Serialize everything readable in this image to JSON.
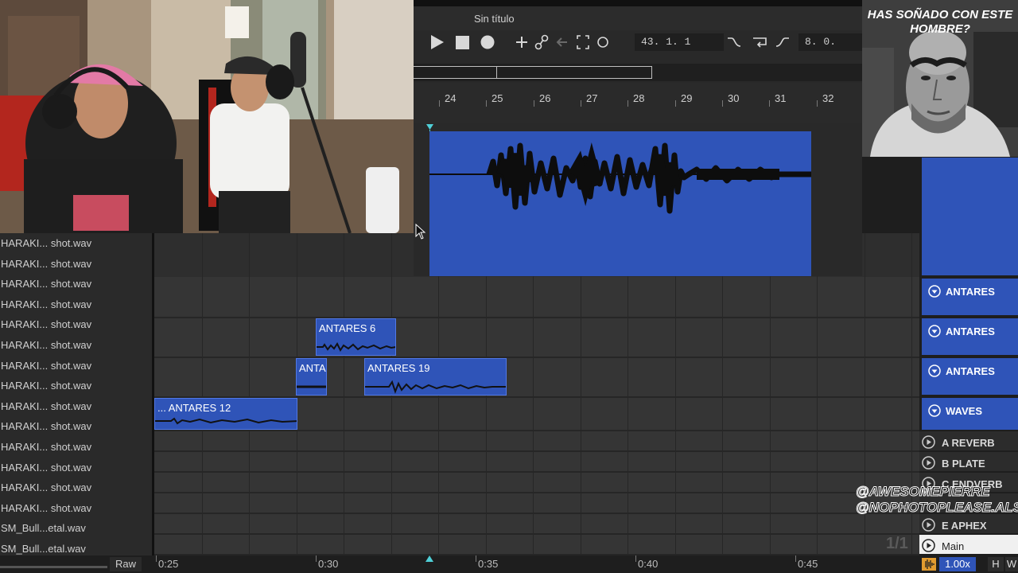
{
  "browser": {
    "files": [
      "HARAKI... shot.wav",
      "HARAKI... shot.wav",
      "HARAKI... shot.wav",
      "HARAKI... shot.wav",
      "HARAKI... shot.wav",
      "HARAKI... shot.wav",
      "HARAKI... shot.wav",
      "HARAKI... shot.wav",
      "HARAKI... shot.wav",
      "HARAKI... shot.wav",
      "HARAKI... shot.wav",
      "HARAKI... shot.wav",
      "HARAKI... shot.wav",
      "HARAKI... shot.wav",
      "SM_Bull...etal.wav",
      "SM_Bull...etal.wav"
    ],
    "raw_label": "Raw"
  },
  "clips": {
    "c1": "ANTARES 6",
    "c2": "ANTA",
    "c3": "ANTARES 19",
    "c4": "... ANTARES 12"
  },
  "tracks": {
    "t1": "ANTARES",
    "t2": "ANTARES",
    "t3": "ANTARES",
    "t4": "WAVES"
  },
  "returns": {
    "r1": "A REVERB",
    "r2": "B PLATE",
    "r3": "C ENDVERB",
    "r4": "E APHEX",
    "r5": "Main"
  },
  "page_counter": "1/1",
  "time_ruler": [
    "0:25",
    "0:30",
    "0:35",
    "0:40",
    "0:45"
  ],
  "status": {
    "zoom": "1.00x",
    "h": "H",
    "w": "W"
  },
  "live": {
    "title": "Sin título",
    "position": "43.   1.   1",
    "end": "8.   0.",
    "beats": [
      "24",
      "25",
      "26",
      "27",
      "28",
      "29",
      "30",
      "31",
      "32"
    ]
  },
  "overlay": {
    "caption": "HAS SOÑADO CON ESTE HOMBRE?",
    "credit1": "@AWESOMEPIERRE",
    "credit2": "@NOPHOTOPLEASE.ALS"
  },
  "colors": {
    "clip": "#2f54b8",
    "clip_border": "#5178e6",
    "playhead": "#4fd0d8"
  }
}
